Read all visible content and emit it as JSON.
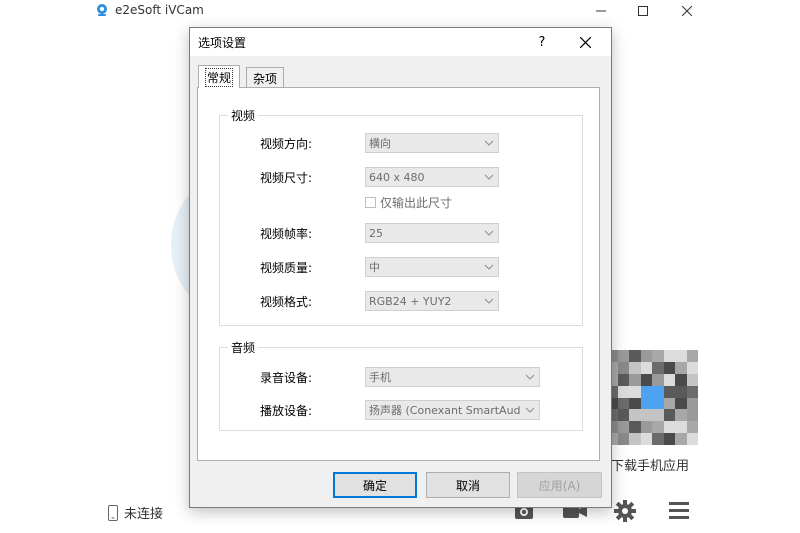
{
  "app": {
    "title": "e2eSoft iVCam",
    "status": "未连接",
    "qr_caption": "码下载手机应用"
  },
  "dialog": {
    "title": "选项设置",
    "help": "?",
    "tabs": [
      {
        "label": "常规",
        "active": true
      },
      {
        "label": "杂项",
        "active": false
      }
    ],
    "video_group": {
      "legend": "视频",
      "orientation": {
        "label": "视频方向:",
        "value": "横向"
      },
      "size": {
        "label": "视频尺寸:",
        "value": "640 x 480"
      },
      "output_only": {
        "label": "仅输出此尺寸",
        "checked": false
      },
      "framerate": {
        "label": "视频帧率:",
        "value": "25"
      },
      "quality": {
        "label": "视频质量:",
        "value": "中"
      },
      "format": {
        "label": "视频格式:",
        "value": "RGB24 + YUY2"
      }
    },
    "audio_group": {
      "legend": "音频",
      "record": {
        "label": "录音设备:",
        "value": "手机"
      },
      "playback": {
        "label": "播放设备:",
        "value": "扬声器 (Conexant SmartAudio H"
      }
    },
    "buttons": {
      "ok": "确定",
      "cancel": "取消",
      "apply": "应用(A)"
    }
  },
  "colors": {
    "accent": "#0078d7",
    "dialog_bg": "#f0f0f0",
    "disabled_combo_bg": "#e9e9e9"
  }
}
